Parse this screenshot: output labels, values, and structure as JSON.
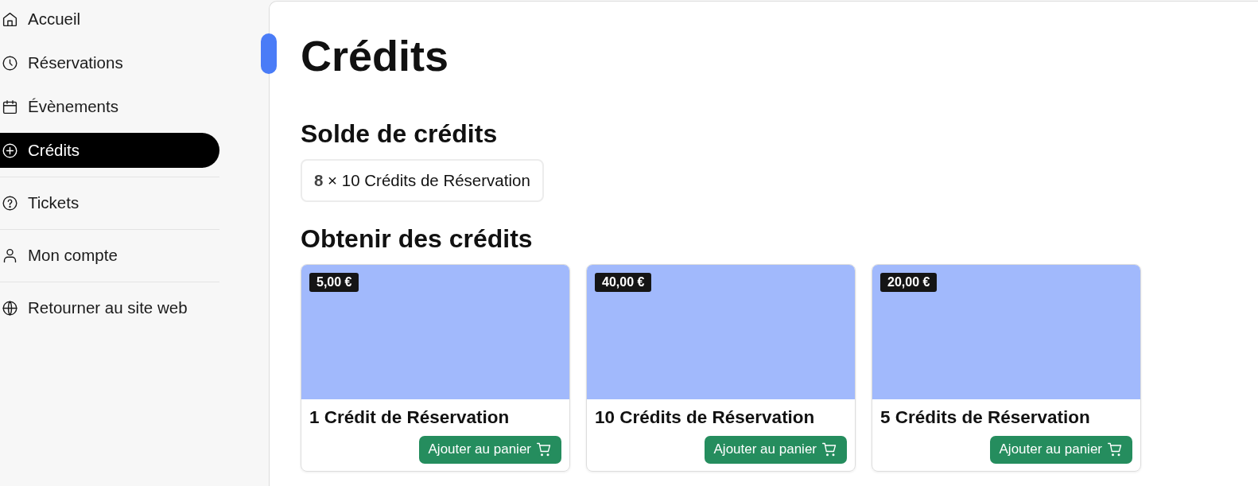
{
  "sidebar": {
    "groups": [
      {
        "items": [
          {
            "kind": "home",
            "label": "Accueil",
            "selected": false
          },
          {
            "kind": "clock",
            "label": "Réservations",
            "selected": false
          },
          {
            "kind": "calendar",
            "label": "Évènements",
            "selected": false
          },
          {
            "kind": "plus-circle",
            "label": "Crédits",
            "selected": true
          }
        ]
      },
      {
        "items": [
          {
            "kind": "question",
            "label": "Tickets",
            "selected": false
          }
        ]
      },
      {
        "items": [
          {
            "kind": "user",
            "label": "Mon compte",
            "selected": false
          }
        ]
      },
      {
        "items": [
          {
            "kind": "globe",
            "label": "Retourner au site web",
            "selected": false
          }
        ]
      }
    ]
  },
  "main": {
    "title": "Crédits",
    "balance": {
      "heading": "Solde de crédits",
      "entries": [
        "**8** × 10 Crédits de Réservation"
      ]
    },
    "shop": {
      "heading": "Obtenir des crédits",
      "products": [
        {
          "price": "5,00 €",
          "name": "1 Crédit de Réservation",
          "button": "Ajouter au panier"
        },
        {
          "price": "40,00 €",
          "name": "10 Crédits de Réservation",
          "button": "Ajouter au panier"
        },
        {
          "price": "20,00 €",
          "name": "5 Crédits de Réservation",
          "button": "Ajouter au panier"
        }
      ]
    }
  }
}
